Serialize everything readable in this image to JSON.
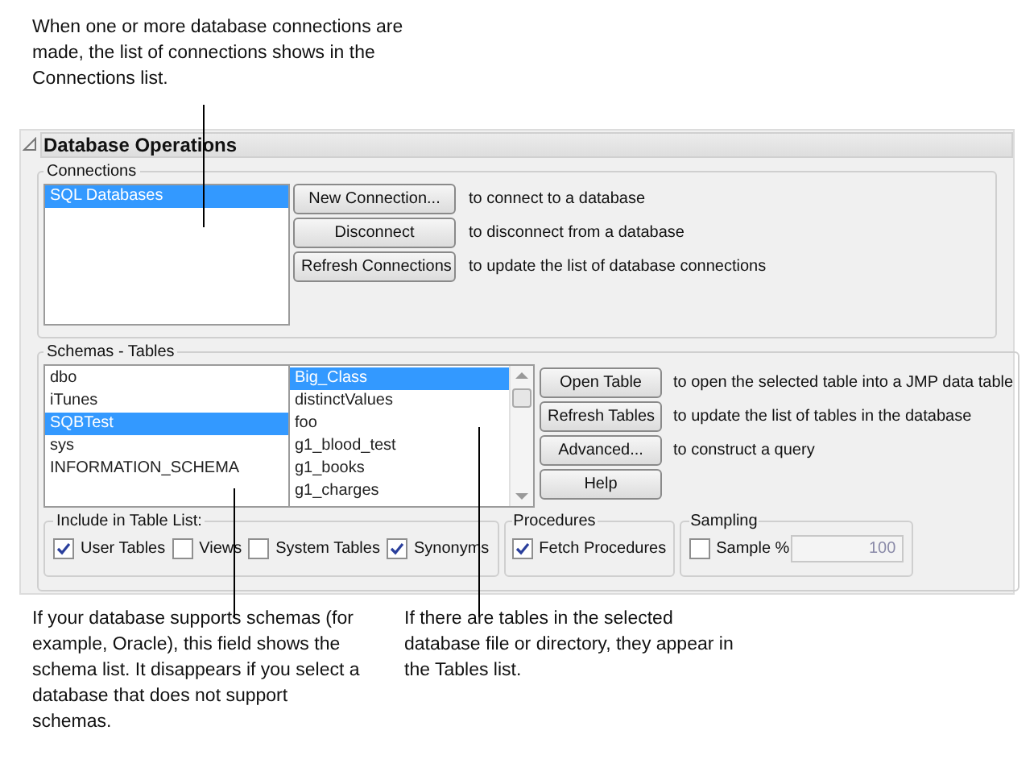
{
  "top_note": "When one or more database connections are made, the list of connections shows in the Connections list.",
  "panel": {
    "title": "Database Operations",
    "expanded": true
  },
  "connections": {
    "label": "Connections",
    "items": [
      {
        "text": "SQL Databases",
        "selected": true
      }
    ],
    "buttons": [
      {
        "label": "New Connection...",
        "description": "to connect to a database"
      },
      {
        "label": "Disconnect",
        "description": "to disconnect from a database"
      },
      {
        "label": "Refresh Connections",
        "description": "to update the list of database connections"
      }
    ]
  },
  "schemas_tables": {
    "label": "Schemas - Tables",
    "schemas": [
      {
        "text": "dbo",
        "selected": false
      },
      {
        "text": "iTunes",
        "selected": false
      },
      {
        "text": "SQBTest",
        "selected": true
      },
      {
        "text": "sys",
        "selected": false
      },
      {
        "text": "INFORMATION_SCHEMA",
        "selected": false
      }
    ],
    "tables": [
      {
        "text": "Big_Class",
        "selected": true
      },
      {
        "text": "distinctValues",
        "selected": false
      },
      {
        "text": "foo",
        "selected": false
      },
      {
        "text": "g1_blood_test",
        "selected": false
      },
      {
        "text": "g1_books",
        "selected": false
      },
      {
        "text": "g1_charges",
        "selected": false
      }
    ],
    "buttons": [
      {
        "label": "Open Table",
        "description": "to open the selected table into a JMP data table"
      },
      {
        "label": "Refresh Tables",
        "description": "to update the list of tables in the database"
      },
      {
        "label": "Advanced...",
        "description": "to construct a query"
      },
      {
        "label": "Help"
      }
    ]
  },
  "include": {
    "label": "Include in Table List:",
    "options": [
      {
        "label": "User Tables",
        "checked": true
      },
      {
        "label": "Views",
        "checked": false
      },
      {
        "label": "System Tables",
        "checked": false
      },
      {
        "label": "Synonyms",
        "checked": true
      }
    ]
  },
  "procedures": {
    "label": "Procedures",
    "options": [
      {
        "label": "Fetch Procedures",
        "checked": true
      }
    ]
  },
  "sampling": {
    "label": "Sampling",
    "option": {
      "label": "Sample %",
      "checked": false
    },
    "value": "100"
  },
  "bottom_notes": [
    "If your database supports schemas (for example, Oracle), this field shows the schema list. It disappears if you select a database that does not support schemas.",
    "If there are tables in the selected database file or directory, they appear in the Tables list."
  ]
}
